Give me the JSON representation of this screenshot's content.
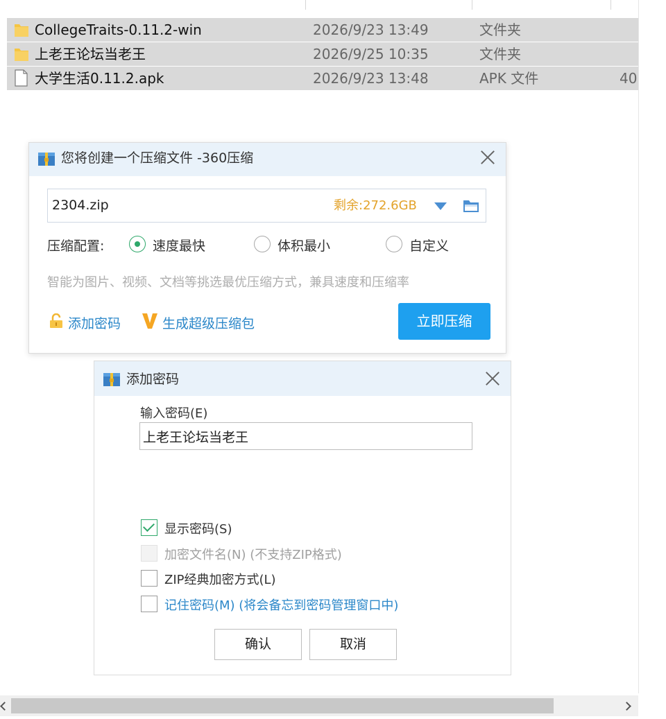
{
  "files": [
    {
      "name": "CollegeTraits-0.11.2-win",
      "modified": "2026/9/23 13:49",
      "type": "文件夹",
      "size": "",
      "icon": "folder-icon"
    },
    {
      "name": "上老王论坛当老王",
      "modified": "2026/9/25 10:35",
      "type": "文件夹",
      "size": "",
      "icon": "folder-icon"
    },
    {
      "name": "大学生活0.11.2.apk",
      "modified": "2026/9/23 13:48",
      "type": "APK 文件",
      "size": "40",
      "icon": "file-icon"
    }
  ],
  "compress_dialog": {
    "title": "您将创建一个压缩文件 -360压缩",
    "path_value": "2304.zip",
    "free_space": "剩余:272.6GB",
    "config_label": "压缩配置:",
    "options": [
      "速度最快",
      "体积最小",
      "自定义"
    ],
    "selected_option": "速度最快",
    "hint": "智能为图片、视频、文档等挑选最优压缩方式，兼具速度和压缩率",
    "add_password_label": "添加密码",
    "generate_super_label": "生成超级压缩包",
    "compress_button": "立即压缩"
  },
  "password_dialog": {
    "title": "添加密码",
    "input_label": "输入密码(E)",
    "password_value": "上老王论坛当老王",
    "checkboxes": [
      {
        "label": "显示密码(S)",
        "checked": true,
        "enabled": true
      },
      {
        "label": "加密文件名(N) (不支持ZIP格式)",
        "checked": false,
        "enabled": false
      },
      {
        "label": "ZIP经典加密方式(L)",
        "checked": false,
        "enabled": true
      },
      {
        "label": "记住密码(M) (将会备忘到密码管理窗口中)",
        "checked": false,
        "enabled": true
      }
    ],
    "ok_button": "确认",
    "cancel_button": "取消"
  },
  "colors": {
    "accent_blue": "#1ea0ef",
    "link_blue": "#2b87c9",
    "check_green": "#2ea86a",
    "free_space_orange": "#e3a32b",
    "titlebar_bg": "#e9f2fa",
    "row_selected_bg": "#d9d9d9"
  }
}
